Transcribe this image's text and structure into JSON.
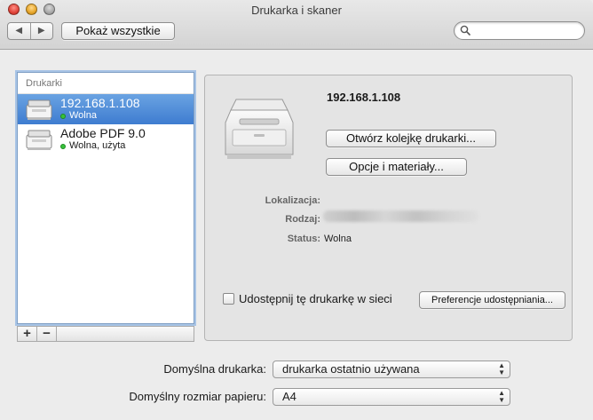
{
  "window": {
    "title": "Drukarka i skaner"
  },
  "toolbar": {
    "back_icon": "◀",
    "forward_icon": "▶",
    "show_all_label": "Pokaż wszystkie",
    "search_placeholder": ""
  },
  "printers": {
    "header": "Drukarki",
    "items": [
      {
        "name": "192.168.1.108",
        "status": "Wolna",
        "selected": true
      },
      {
        "name": "Adobe PDF 9.0",
        "status": "Wolna, użyta",
        "selected": false
      }
    ],
    "add_label": "+",
    "remove_label": "−"
  },
  "details": {
    "printer_name": "192.168.1.108",
    "open_queue_label": "Otwórz kolejkę drukarki...",
    "options_label": "Opcje i materiały...",
    "location_label": "Lokalizacja:",
    "location_value": "",
    "kind_label": "Rodzaj:",
    "status_label": "Status:",
    "status_value": "Wolna",
    "share_label": "Udostępnij tę drukarkę w sieci",
    "share_checked": false,
    "sharing_prefs_label": "Preferencje udostępniania..."
  },
  "defaults": {
    "default_printer_label": "Domyślna drukarka:",
    "default_printer_value": "drukarka ostatnio używana",
    "default_paper_label": "Domyślny rozmiar papieru:",
    "default_paper_value": "A4"
  },
  "colors": {
    "selection": "#3e7cd0",
    "status_dot": "#38c23b"
  }
}
